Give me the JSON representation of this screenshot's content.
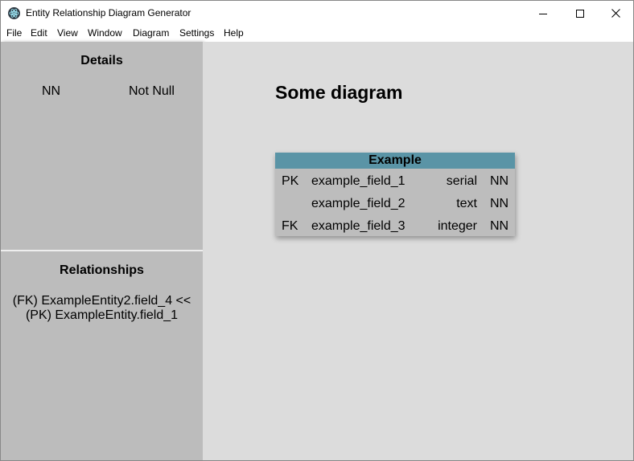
{
  "window": {
    "title": "Entity Relationship Diagram Generator",
    "icon": "electron-atom-icon"
  },
  "menu": [
    "File",
    "Edit",
    "View",
    "Window",
    "Diagram",
    "Settings",
    "Help"
  ],
  "sidebar": {
    "details": {
      "title": "Details",
      "key": "NN",
      "value": "Not Null"
    },
    "relationships": {
      "title": "Relationships",
      "items": [
        {
          "line1": "(FK) ExampleEntity2.field_4 <<",
          "line2": "(PK) ExampleEntity.field_1"
        }
      ]
    }
  },
  "diagram": {
    "title": "Some diagram",
    "entities": [
      {
        "name": "Example",
        "header_color": "#5a94a6",
        "fields": [
          {
            "key": "PK",
            "name": "example_field_1",
            "type": "serial",
            "nullability": "NN"
          },
          {
            "key": "",
            "name": "example_field_2",
            "type": "text",
            "nullability": "NN"
          },
          {
            "key": "FK",
            "name": "example_field_3",
            "type": "integer",
            "nullability": "NN"
          }
        ]
      }
    ]
  },
  "colors": {
    "sidebar_bg": "#bcbcbc",
    "canvas_bg": "#dcdcdc",
    "entity_bg": "#bdbdbd"
  }
}
